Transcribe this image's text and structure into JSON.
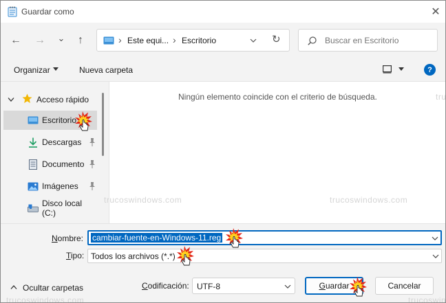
{
  "window": {
    "title": "Guardar como",
    "close_glyph": "✕"
  },
  "nav": {
    "back_glyph": "←",
    "forward_glyph": "→",
    "recent_glyph": "⌄",
    "up_glyph": "↑"
  },
  "address": {
    "separator": "›",
    "crumbs": [
      "Este equi...",
      "Escritorio"
    ],
    "refresh_glyph": "↻"
  },
  "search": {
    "placeholder": "Buscar en Escritorio"
  },
  "toolbar": {
    "organize_label": "Organizar",
    "new_folder_label": "Nueva carpeta",
    "help_glyph": "?"
  },
  "sidebar": {
    "quick_access": "Acceso rápido",
    "items": [
      {
        "label": "Escritorio"
      },
      {
        "label": "Descargas"
      },
      {
        "label": "Documento"
      },
      {
        "label": "Imágenes"
      },
      {
        "label": "Disco local (C:)"
      }
    ]
  },
  "main": {
    "empty_message": "Ningún elemento coincide con el criterio de búsqueda.",
    "watermark": "trucoswindows.com"
  },
  "form": {
    "name_label_pre": "N",
    "name_label_rest": "ombre:",
    "name_value": "cambiar-fuente-en-Windows-11.reg",
    "type_label_pre": "T",
    "type_label_rest": "ipo:",
    "type_value": "Todos los archivos  (*.*)",
    "encoding_label_pre": "C",
    "encoding_label_rest": "odificación:",
    "encoding_value": "UTF-8",
    "hide_folders_label": "Ocultar carpetas",
    "save_label_pre": "G",
    "save_label_rest": "uardar",
    "cancel_label": "Cancelar"
  },
  "colors": {
    "accent": "#0067c0",
    "folder_blue": "#3a8fd6",
    "star": "#f2b705",
    "download_green": "#1e9e63",
    "burst_yellow": "#ffd21f",
    "burst_red": "#e3261b"
  }
}
